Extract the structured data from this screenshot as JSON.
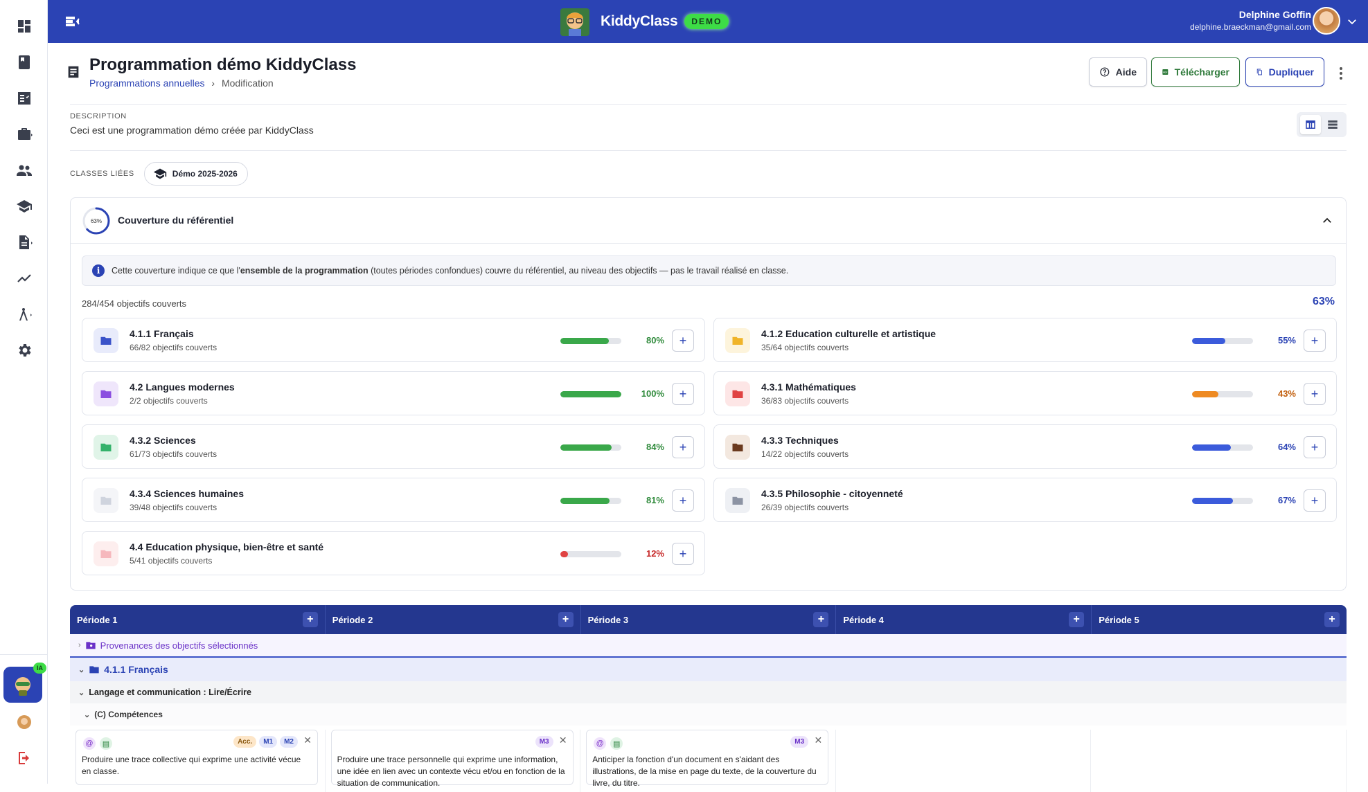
{
  "app": {
    "name": "KiddyClass",
    "badge": "DEMO"
  },
  "user": {
    "name": "Delphine Goffin",
    "email": "delphine.braeckman@gmail.com"
  },
  "sidebar": {
    "ia_badge": "IA"
  },
  "page": {
    "title": "Programmation démo KiddyClass",
    "breadcrumb_link": "Programmations annuelles",
    "breadcrumb_sep": "›",
    "breadcrumb_current": "Modification"
  },
  "actions": {
    "help": "Aide",
    "download": "Télécharger",
    "duplicate": "Dupliquer"
  },
  "description": {
    "label": "DESCRIPTION",
    "text": "Ceci est une programmation démo créée par KiddyClass"
  },
  "classes": {
    "label": "CLASSES LIÉES",
    "chip": "Démo 2025-2026"
  },
  "coverage": {
    "ring_label": "63%",
    "ring_value": 63,
    "title": "Couverture du référentiel",
    "info_pre": "Cette couverture indique ce que l'",
    "info_bold": "ensemble de la programmation",
    "info_post": " (toutes périodes confondues) couvre du référentiel, au niveau des objectifs — pas le travail réalisé en classe.",
    "count": "284/454 objectifs couverts",
    "percent": "63%",
    "domains": [
      {
        "name": "4.1.1 Français",
        "sub": "66/82 objectifs couverts",
        "pct": "80%",
        "value": 80,
        "bar": "#3aa84a",
        "text": "#2f8a3b",
        "folder": "#3b53c9",
        "bg": "#e8ebfb"
      },
      {
        "name": "4.1.2 Education culturelle et artistique",
        "sub": "35/64 objectifs couverts",
        "pct": "55%",
        "value": 55,
        "bar": "#3b5bdb",
        "text": "#2b43b4",
        "folder": "#f0b429",
        "bg": "#fdf4dc"
      },
      {
        "name": "4.2 Langues modernes",
        "sub": "2/2 objectifs couverts",
        "pct": "100%",
        "value": 100,
        "bar": "#3aa84a",
        "text": "#2f8a3b",
        "folder": "#8b4fe0",
        "bg": "#efe6fb"
      },
      {
        "name": "4.3.1 Mathématiques",
        "sub": "36/83 objectifs couverts",
        "pct": "43%",
        "value": 43,
        "bar": "#ee8a22",
        "text": "#c2600f",
        "folder": "#e04343",
        "bg": "#fde6e6"
      },
      {
        "name": "4.3.2 Sciences",
        "sub": "61/73 objectifs couverts",
        "pct": "84%",
        "value": 84,
        "bar": "#3aa84a",
        "text": "#2f8a3b",
        "folder": "#34b26b",
        "bg": "#e0f4e8"
      },
      {
        "name": "4.3.3 Techniques",
        "sub": "14/22 objectifs couverts",
        "pct": "64%",
        "value": 64,
        "bar": "#3b5bdb",
        "text": "#2b43b4",
        "folder": "#6b3a1f",
        "bg": "#f3e8df"
      },
      {
        "name": "4.3.4 Sciences humaines",
        "sub": "39/48 objectifs couverts",
        "pct": "81%",
        "value": 81,
        "bar": "#3aa84a",
        "text": "#2f8a3b",
        "folder": "#cfd4de",
        "bg": "#f4f5f8"
      },
      {
        "name": "4.3.5 Philosophie - citoyenneté",
        "sub": "26/39 objectifs couverts",
        "pct": "67%",
        "value": 67,
        "bar": "#3b5bdb",
        "text": "#2b43b4",
        "folder": "#8c93a3",
        "bg": "#eef0f4"
      },
      {
        "name": "4.4 Education physique, bien-être et santé",
        "sub": "5/41 objectifs couverts",
        "pct": "12%",
        "value": 12,
        "bar": "#e04343",
        "text": "#c62828",
        "folder": "#f6b8bd",
        "bg": "#fdeeee"
      }
    ]
  },
  "periods": [
    "Période 1",
    "Période 2",
    "Période 3",
    "Période 4",
    "Période 5"
  ],
  "rows": {
    "provenances": "Provenances des objectifs sélectionnés",
    "domain": "4.1.1 Français",
    "sub": "Langage et communication : Lire/Écrire",
    "comp": "(C) Compétences"
  },
  "objectives": [
    {
      "text": "Produire une trace collective qui exprime une activité vécue en classe.",
      "tags": [
        "Acc.",
        "M1",
        "M2"
      ]
    },
    {
      "text": "Produire une trace personnelle qui exprime une information, une idée en lien avec un contexte vécu et/ou en fonction de la situation de communication.",
      "tags": [
        "M3"
      ]
    },
    {
      "text": "Anticiper la fonction d'un document en s'aidant des illustrations, de la mise en page du texte, de la couverture du livre, du titre.",
      "tags": [
        "M3"
      ]
    }
  ]
}
